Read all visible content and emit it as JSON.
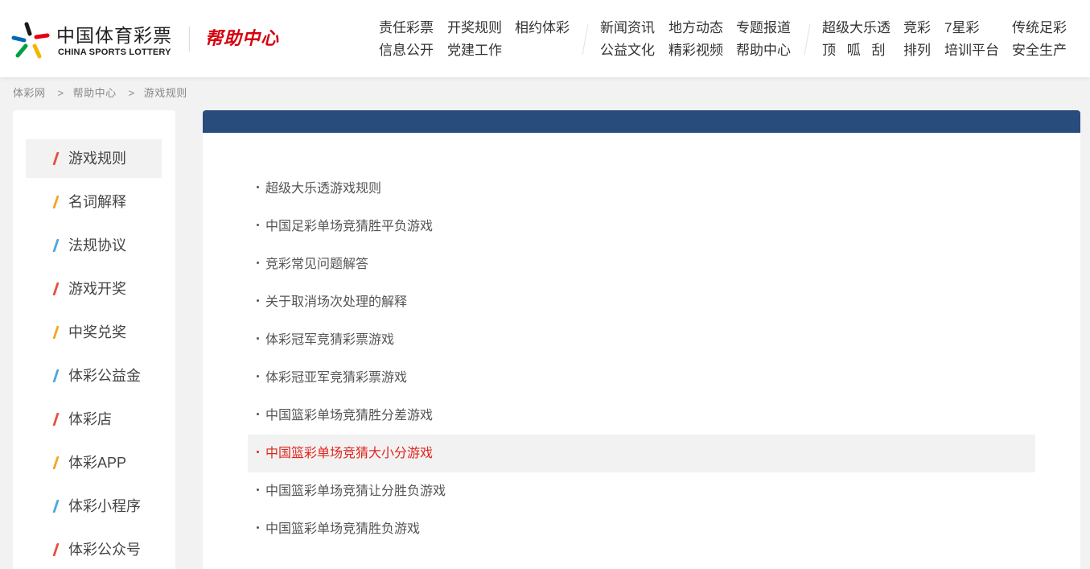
{
  "header": {
    "logo": {
      "cn": "中国体育彩票",
      "en": "CHINA SPORTS LOTTERY"
    },
    "section_title": "帮助中心",
    "nav": {
      "group1": {
        "row1": [
          "责任彩票",
          "开奖规则",
          "相约体彩"
        ],
        "row2": [
          "信息公开",
          "党建工作"
        ]
      },
      "group2": {
        "row1": [
          "新闻资讯",
          "地方动态",
          "专题报道"
        ],
        "row2": [
          "公益文化",
          "精彩视频",
          "帮助中心"
        ]
      },
      "group3": {
        "row1": [
          "超级大乐透",
          "竞彩",
          "7星彩",
          "传统足彩"
        ],
        "row2": [
          "顶 呱 刮",
          "排列",
          "培训平台",
          "安全生产"
        ]
      }
    }
  },
  "breadcrumb": {
    "separator": ">",
    "items": [
      "体彩网",
      "帮助中心",
      "游戏规则"
    ]
  },
  "sidebar": {
    "items": [
      {
        "label": "游戏规则",
        "color": "#e8503e",
        "active": true
      },
      {
        "label": "名词解释",
        "color": "#f5a623",
        "active": false
      },
      {
        "label": "法规协议",
        "color": "#4fa6e0",
        "active": false
      },
      {
        "label": "游戏开奖",
        "color": "#e8503e",
        "active": false
      },
      {
        "label": "中奖兑奖",
        "color": "#f5a623",
        "active": false
      },
      {
        "label": "体彩公益金",
        "color": "#4fa6e0",
        "active": false
      },
      {
        "label": "体彩店",
        "color": "#e8503e",
        "active": false
      },
      {
        "label": "体彩APP",
        "color": "#f5a623",
        "active": false
      },
      {
        "label": "体彩小程序",
        "color": "#4fa6e0",
        "active": false
      },
      {
        "label": "体彩公众号",
        "color": "#e8503e",
        "active": false
      }
    ]
  },
  "main": {
    "articles": [
      {
        "title": "超级大乐透游戏规则",
        "active": false
      },
      {
        "title": "中国足彩单场竞猜胜平负游戏",
        "active": false
      },
      {
        "title": "竞彩常见问题解答",
        "active": false
      },
      {
        "title": "关于取消场次处理的解释",
        "active": false
      },
      {
        "title": "体彩冠军竞猜彩票游戏",
        "active": false
      },
      {
        "title": "体彩冠亚军竞猜彩票游戏",
        "active": false
      },
      {
        "title": "中国篮彩单场竞猜胜分差游戏",
        "active": false
      },
      {
        "title": "中国篮彩单场竞猜大小分游戏",
        "active": true
      },
      {
        "title": "中国篮彩单场竞猜让分胜负游戏",
        "active": false
      },
      {
        "title": "中国篮彩单场竞猜胜负游戏",
        "active": false
      }
    ]
  },
  "colors": {
    "header_bar": "#284d7c",
    "highlight_text": "#e0261d",
    "active_bg": "#f2f2f2",
    "section_title": "#d7000f"
  }
}
